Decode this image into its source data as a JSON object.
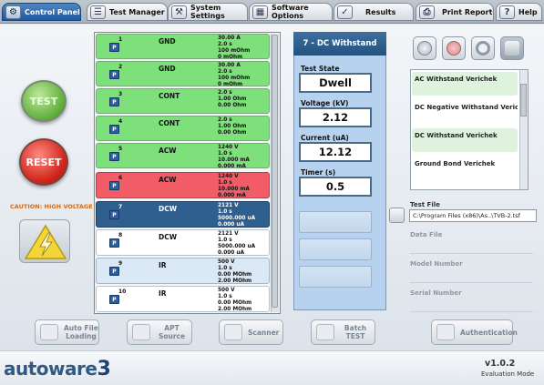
{
  "tabs": [
    {
      "label": "Control Panel",
      "icon": "control-panel-icon"
    },
    {
      "label": "Test Manager",
      "icon": "test-manager-icon"
    },
    {
      "label": "System Settings",
      "icon": "settings-icon"
    },
    {
      "label": "Software Options",
      "icon": "software-options-icon"
    },
    {
      "label": "Results",
      "icon": "results-icon"
    },
    {
      "label": "Print Report",
      "icon": "printer-icon"
    },
    {
      "label": "Help",
      "icon": "help-icon"
    }
  ],
  "controls": {
    "test_label": "TEST",
    "reset_label": "RESET",
    "caution": "CAUTION: HIGH VOLTAGE"
  },
  "steps": [
    {
      "num": "1",
      "type": "GND",
      "params": [
        "30.00 A",
        "2.0 s",
        "100 mOhm",
        "0 mOhm"
      ]
    },
    {
      "num": "2",
      "type": "GND",
      "params": [
        "30.00 A",
        "2.0 s",
        "100 mOhm",
        "0 mOhm"
      ]
    },
    {
      "num": "3",
      "type": "CONT",
      "params": [
        "2.0 s",
        "1.00 Ohm",
        "0.00 Ohm"
      ]
    },
    {
      "num": "4",
      "type": "CONT",
      "params": [
        "2.0 s",
        "1.00 Ohm",
        "0.00 Ohm"
      ]
    },
    {
      "num": "5",
      "type": "ACW",
      "params": [
        "1240 V",
        "1.0 s",
        "10.000 mA",
        "0.000 mA"
      ]
    },
    {
      "num": "6",
      "type": "ACW",
      "params": [
        "1240 V",
        "1.0 s",
        "10.000 mA",
        "0.000 mA"
      ]
    },
    {
      "num": "7",
      "type": "DCW",
      "params": [
        "2121 V",
        "1.0 s",
        "5000.000 uA",
        "0.000 uA"
      ]
    },
    {
      "num": "8",
      "type": "DCW",
      "params": [
        "2121 V",
        "1.0 s",
        "5000.000 uA",
        "0.000 uA"
      ]
    },
    {
      "num": "9",
      "type": "IR",
      "params": [
        "500 V",
        "1.0 s",
        "0.00 MOhm",
        "2.00 MOhm"
      ]
    },
    {
      "num": "10",
      "type": "IR",
      "params": [
        "500 V",
        "1.0 s",
        "0.00 MOhm",
        "2.00 MOhm"
      ]
    }
  ],
  "step_badge": "P",
  "readout": {
    "title": "7 - DC Withstand",
    "state_label": "Test State",
    "state_value": "Dwell",
    "voltage_label": "Voltage (kV)",
    "voltage_value": "2.12",
    "current_label": "Current (uA)",
    "current_value": "12.12",
    "timer_label": "Timer (s)",
    "timer_value": "0.5"
  },
  "verichek": [
    "AC Withstand Verichek",
    "DC Negative Withstand Verichek",
    "DC Withstand Verichek",
    "Ground Bond Verichek"
  ],
  "files": {
    "test_file_label": "Test File",
    "test_file_value": "C:\\Program Files (x86)\\As..\\TVB-2.tsf",
    "data_file_label": "Data File",
    "model_number_label": "Model Number",
    "serial_number_label": "Serial Number"
  },
  "bottom_buttons": [
    {
      "label": "Auto File\nLoading"
    },
    {
      "label": "APT\nSource"
    },
    {
      "label": "Scanner"
    },
    {
      "label": "Batch\nTEST"
    },
    {
      "label": "Authentication"
    }
  ],
  "footer": {
    "logo_text": "autoware",
    "logo_num": "3",
    "version": "v1.0.2",
    "mode": "Evaluation Mode"
  },
  "colors": {
    "pass_green": "#7ee07a",
    "fail_red": "#f25c66",
    "selected_blue": "#2f5f8e",
    "accent": "#24527f"
  }
}
